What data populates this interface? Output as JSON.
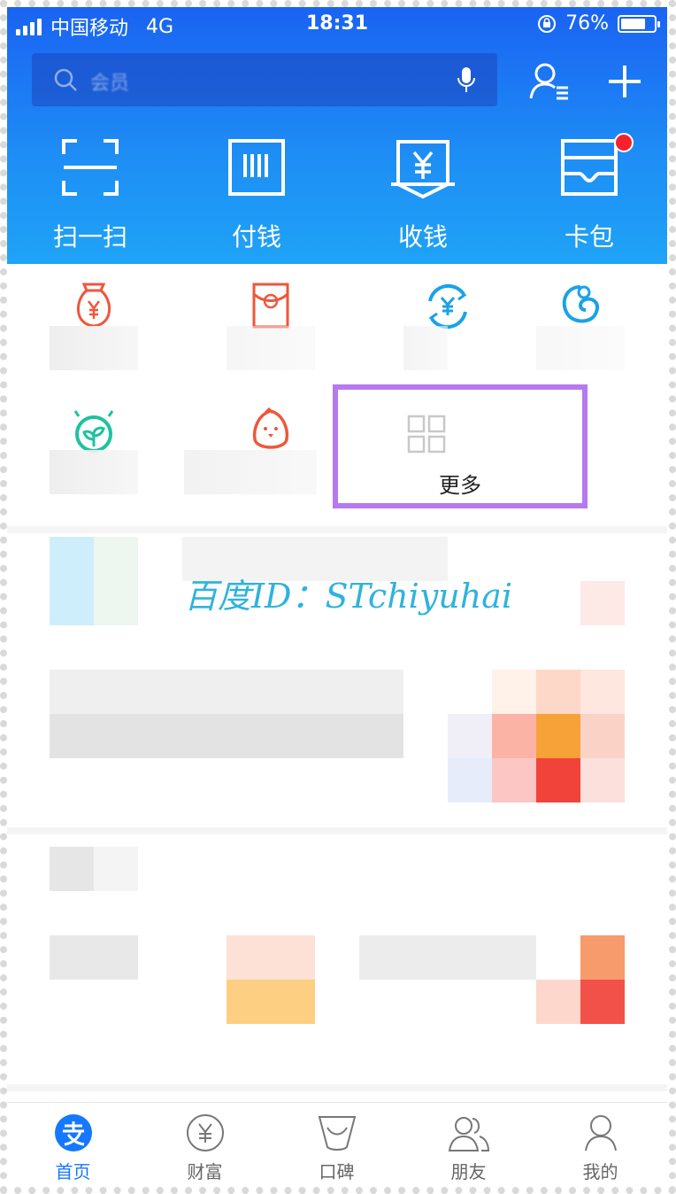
{
  "status_bar": {
    "carrier": "中国移动",
    "network": "4G",
    "time": "18:31",
    "battery": "76%",
    "battery_level": 0.76
  },
  "header": {
    "search_placeholder": "会员",
    "contacts_icon": "contacts-icon",
    "add_icon": "plus-icon",
    "quick_actions": [
      {
        "label": "扫一扫",
        "icon": "scan-icon"
      },
      {
        "label": "付钱",
        "icon": "barcode-icon"
      },
      {
        "label": "收钱",
        "icon": "yuan-receive-icon"
      },
      {
        "label": "卡包",
        "icon": "card-wallet-icon",
        "badge": true
      }
    ]
  },
  "services": {
    "more_label": "更多",
    "icons": [
      "money-bag-icon",
      "red-envelope-icon",
      "yuan-exchange-icon",
      "ant-icon",
      "sprout-icon",
      "chick-icon",
      "grid-icon"
    ]
  },
  "watermark": "百度ID：STchiyuhai",
  "tabbar": [
    {
      "label": "首页",
      "icon": "alipay-home-icon",
      "active": true
    },
    {
      "label": "财富",
      "icon": "yuan-circle-icon",
      "active": false
    },
    {
      "label": "口碑",
      "icon": "koubei-icon",
      "active": false
    },
    {
      "label": "朋友",
      "icon": "friends-icon",
      "active": false
    },
    {
      "label": "我的",
      "icon": "profile-icon",
      "active": false
    }
  ],
  "colors": {
    "header_top": "#1a63f2",
    "header_bottom": "#1fa3f7",
    "highlight_border": "#b679ef",
    "badge": "#f5222d",
    "active_tab": "#1677ff",
    "watermark": "#2fb3dd"
  }
}
